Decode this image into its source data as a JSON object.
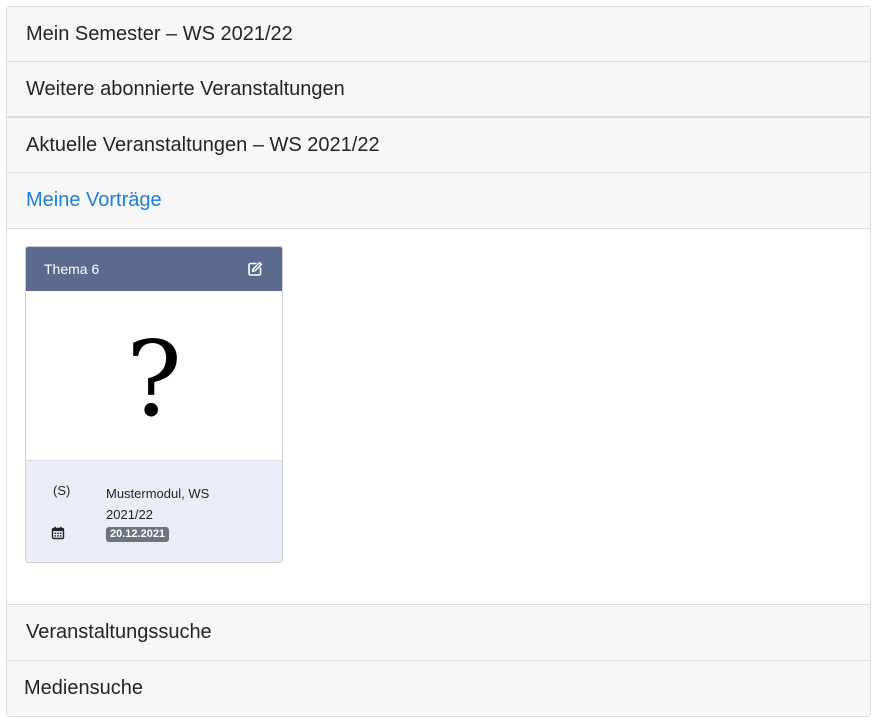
{
  "accordion": {
    "sections": [
      {
        "label": "Mein Semester – WS 2021/22"
      },
      {
        "label": "Weitere abonnierte Veranstaltungen"
      },
      {
        "label": "Aktuelle Veranstaltungen – WS 2021/22"
      },
      {
        "label": "Meine Vorträge"
      },
      {
        "label": "Veranstaltungssuche"
      },
      {
        "label": "Mediensuche"
      }
    ],
    "active_section": "Meine Vorträge"
  },
  "talk_card": {
    "title": "Thema 6",
    "edit_icon": "edit-icon",
    "thumbnail_placeholder": "?",
    "type": "(S)",
    "module": "Mustermodul, WS 2021/22",
    "calendar_icon": "calendar-icon",
    "date": "20.12.2021"
  },
  "colors": {
    "card_header": "#5b6a8e",
    "card_footer": "#eaedf5",
    "active_link": "#1a7fe0",
    "badge": "#6c757d",
    "header_bg": "#f7f7f7"
  }
}
